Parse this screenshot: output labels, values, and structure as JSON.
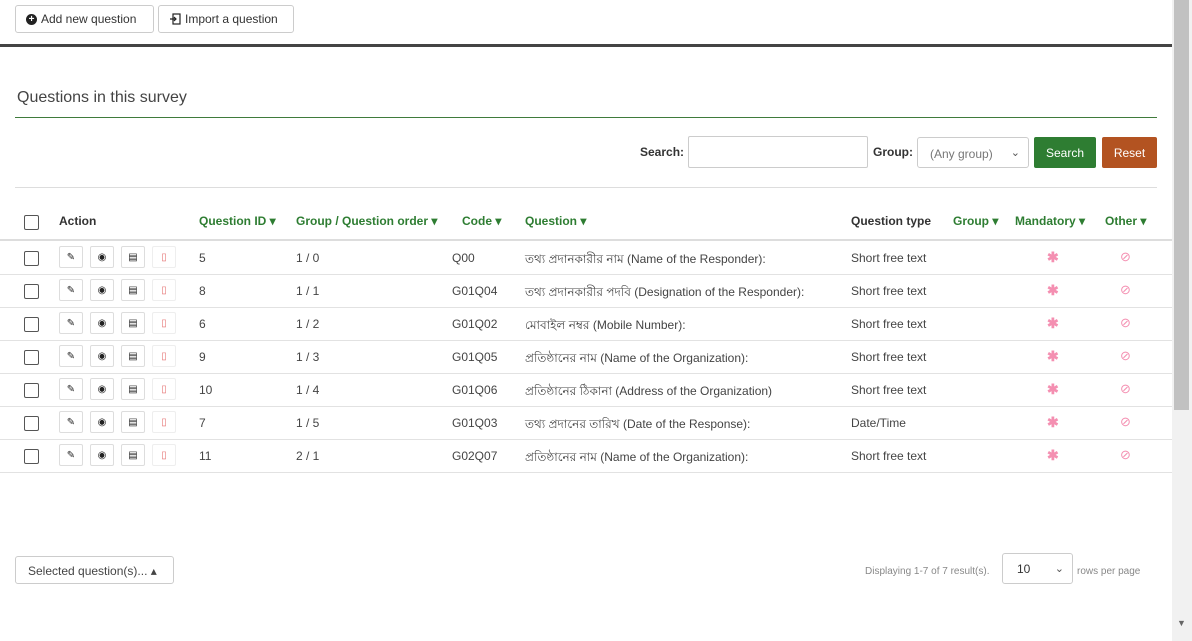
{
  "toolbar": {
    "add_label": "Add new question",
    "import_label": "Import a question"
  },
  "section": {
    "title": "Questions in this survey"
  },
  "filters": {
    "search_label": "Search:",
    "search_value": "",
    "group_label": "Group:",
    "group_value": "(Any group)",
    "search_button": "Search",
    "reset_button": "Reset"
  },
  "table": {
    "headers": {
      "action": "Action",
      "question_id": "Question ID ▾",
      "group_order": "Group / Question order ▾",
      "code": "Code ▾",
      "question": "Question ▾",
      "question_type": "Question type",
      "group": "Group ▾",
      "mandatory": "Mandatory ▾",
      "other": "Other ▾"
    },
    "rows": [
      {
        "id": "5",
        "order": "1 / 0",
        "code": "Q00",
        "question": "তথ্য প্রদানকারীর নাম (Name of the Responder):",
        "type": "Short free text"
      },
      {
        "id": "8",
        "order": "1 / 1",
        "code": "G01Q04",
        "question": "তথ্য প্রদানকারীর পদবি (Designation of the Responder):",
        "type": "Short free text"
      },
      {
        "id": "6",
        "order": "1 / 2",
        "code": "G01Q02",
        "question": "মোবাইল নম্বর (Mobile Number):",
        "type": "Short free text"
      },
      {
        "id": "9",
        "order": "1 / 3",
        "code": "G01Q05",
        "question": "প্রতিষ্ঠানের নাম (Name of the Organization):",
        "type": "Short free text"
      },
      {
        "id": "10",
        "order": "1 / 4",
        "code": "G01Q06",
        "question": "প্রতিষ্ঠানের ঠিকানা (Address of the Organization)",
        "type": "Short free text"
      },
      {
        "id": "7",
        "order": "1 / 5",
        "code": "G01Q03",
        "question": "তথ্য প্রদানের তারিখ (Date of the Response):",
        "type": "Date/Time"
      },
      {
        "id": "11",
        "order": "2 / 1",
        "code": "G02Q07",
        "question": "প্রতিষ্ঠানের নাম (Name of the Organization):",
        "type": "Short free text"
      }
    ]
  },
  "footer": {
    "selected_label": "Selected question(s)... ▴",
    "displaying": "Displaying 1-7 of 7 result(s).",
    "page_size": "10",
    "rows_per_page": "rows per page"
  }
}
